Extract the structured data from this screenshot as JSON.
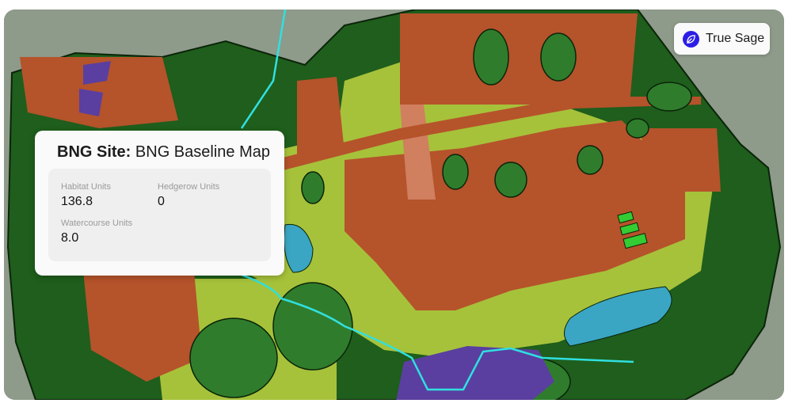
{
  "brand": {
    "name": "True Sage",
    "icon": "leaf-icon",
    "accent": "#2b1ee6"
  },
  "card": {
    "title_prefix": "BNG Site:",
    "title": "BNG Baseline Map",
    "stats": [
      {
        "label": "Habitat Units",
        "value": "136.8"
      },
      {
        "label": "Hedgerow Units",
        "value": "0"
      },
      {
        "label": "Watercourse Units",
        "value": "8.0"
      }
    ]
  },
  "legend_colors": {
    "woodland": "#1f5e1c",
    "buildings": "#b5532b",
    "grassland": "#a6c23a",
    "water": "#3aa6c4",
    "wetland": "#5a3fa0",
    "river": "#30e0e0"
  }
}
